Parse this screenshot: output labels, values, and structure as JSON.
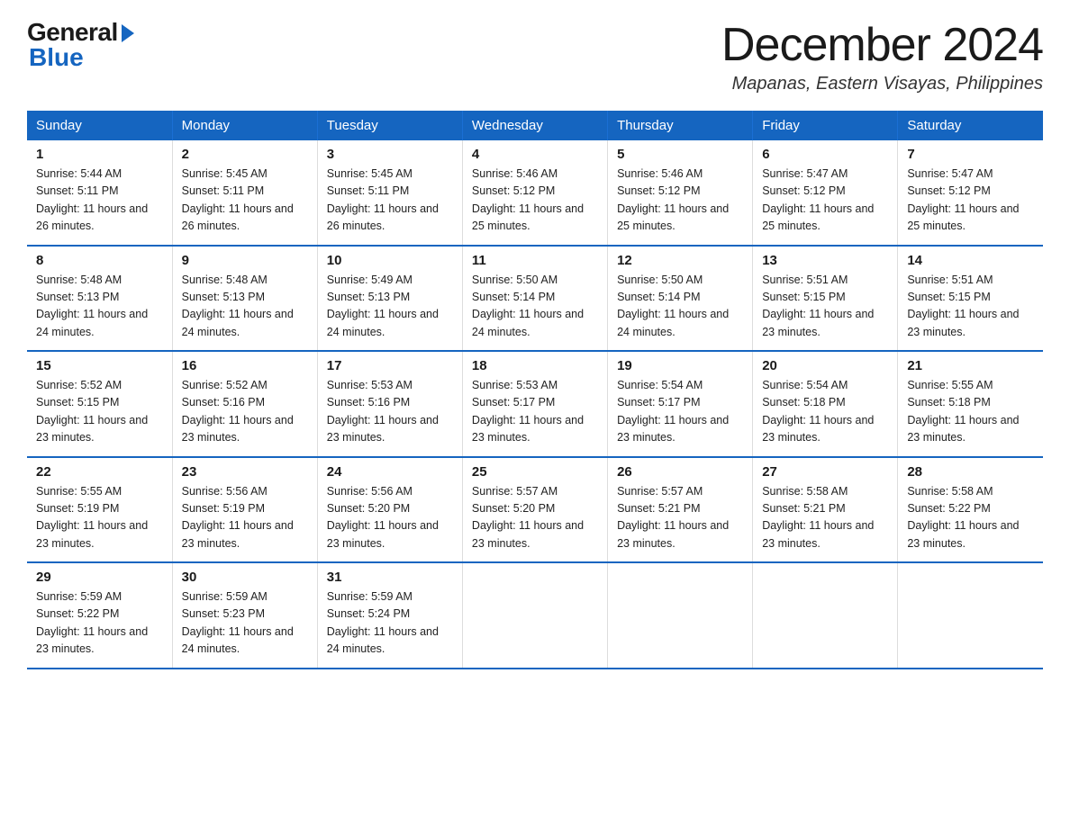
{
  "logo": {
    "general": "General",
    "blue": "Blue"
  },
  "header": {
    "month": "December 2024",
    "location": "Mapanas, Eastern Visayas, Philippines"
  },
  "weekdays": [
    "Sunday",
    "Monday",
    "Tuesday",
    "Wednesday",
    "Thursday",
    "Friday",
    "Saturday"
  ],
  "weeks": [
    [
      {
        "day": "1",
        "sunrise": "5:44 AM",
        "sunset": "5:11 PM",
        "daylight": "11 hours and 26 minutes."
      },
      {
        "day": "2",
        "sunrise": "5:45 AM",
        "sunset": "5:11 PM",
        "daylight": "11 hours and 26 minutes."
      },
      {
        "day": "3",
        "sunrise": "5:45 AM",
        "sunset": "5:11 PM",
        "daylight": "11 hours and 26 minutes."
      },
      {
        "day": "4",
        "sunrise": "5:46 AM",
        "sunset": "5:12 PM",
        "daylight": "11 hours and 25 minutes."
      },
      {
        "day": "5",
        "sunrise": "5:46 AM",
        "sunset": "5:12 PM",
        "daylight": "11 hours and 25 minutes."
      },
      {
        "day": "6",
        "sunrise": "5:47 AM",
        "sunset": "5:12 PM",
        "daylight": "11 hours and 25 minutes."
      },
      {
        "day": "7",
        "sunrise": "5:47 AM",
        "sunset": "5:12 PM",
        "daylight": "11 hours and 25 minutes."
      }
    ],
    [
      {
        "day": "8",
        "sunrise": "5:48 AM",
        "sunset": "5:13 PM",
        "daylight": "11 hours and 24 minutes."
      },
      {
        "day": "9",
        "sunrise": "5:48 AM",
        "sunset": "5:13 PM",
        "daylight": "11 hours and 24 minutes."
      },
      {
        "day": "10",
        "sunrise": "5:49 AM",
        "sunset": "5:13 PM",
        "daylight": "11 hours and 24 minutes."
      },
      {
        "day": "11",
        "sunrise": "5:50 AM",
        "sunset": "5:14 PM",
        "daylight": "11 hours and 24 minutes."
      },
      {
        "day": "12",
        "sunrise": "5:50 AM",
        "sunset": "5:14 PM",
        "daylight": "11 hours and 24 minutes."
      },
      {
        "day": "13",
        "sunrise": "5:51 AM",
        "sunset": "5:15 PM",
        "daylight": "11 hours and 23 minutes."
      },
      {
        "day": "14",
        "sunrise": "5:51 AM",
        "sunset": "5:15 PM",
        "daylight": "11 hours and 23 minutes."
      }
    ],
    [
      {
        "day": "15",
        "sunrise": "5:52 AM",
        "sunset": "5:15 PM",
        "daylight": "11 hours and 23 minutes."
      },
      {
        "day": "16",
        "sunrise": "5:52 AM",
        "sunset": "5:16 PM",
        "daylight": "11 hours and 23 minutes."
      },
      {
        "day": "17",
        "sunrise": "5:53 AM",
        "sunset": "5:16 PM",
        "daylight": "11 hours and 23 minutes."
      },
      {
        "day": "18",
        "sunrise": "5:53 AM",
        "sunset": "5:17 PM",
        "daylight": "11 hours and 23 minutes."
      },
      {
        "day": "19",
        "sunrise": "5:54 AM",
        "sunset": "5:17 PM",
        "daylight": "11 hours and 23 minutes."
      },
      {
        "day": "20",
        "sunrise": "5:54 AM",
        "sunset": "5:18 PM",
        "daylight": "11 hours and 23 minutes."
      },
      {
        "day": "21",
        "sunrise": "5:55 AM",
        "sunset": "5:18 PM",
        "daylight": "11 hours and 23 minutes."
      }
    ],
    [
      {
        "day": "22",
        "sunrise": "5:55 AM",
        "sunset": "5:19 PM",
        "daylight": "11 hours and 23 minutes."
      },
      {
        "day": "23",
        "sunrise": "5:56 AM",
        "sunset": "5:19 PM",
        "daylight": "11 hours and 23 minutes."
      },
      {
        "day": "24",
        "sunrise": "5:56 AM",
        "sunset": "5:20 PM",
        "daylight": "11 hours and 23 minutes."
      },
      {
        "day": "25",
        "sunrise": "5:57 AM",
        "sunset": "5:20 PM",
        "daylight": "11 hours and 23 minutes."
      },
      {
        "day": "26",
        "sunrise": "5:57 AM",
        "sunset": "5:21 PM",
        "daylight": "11 hours and 23 minutes."
      },
      {
        "day": "27",
        "sunrise": "5:58 AM",
        "sunset": "5:21 PM",
        "daylight": "11 hours and 23 minutes."
      },
      {
        "day": "28",
        "sunrise": "5:58 AM",
        "sunset": "5:22 PM",
        "daylight": "11 hours and 23 minutes."
      }
    ],
    [
      {
        "day": "29",
        "sunrise": "5:59 AM",
        "sunset": "5:22 PM",
        "daylight": "11 hours and 23 minutes."
      },
      {
        "day": "30",
        "sunrise": "5:59 AM",
        "sunset": "5:23 PM",
        "daylight": "11 hours and 24 minutes."
      },
      {
        "day": "31",
        "sunrise": "5:59 AM",
        "sunset": "5:24 PM",
        "daylight": "11 hours and 24 minutes."
      },
      null,
      null,
      null,
      null
    ]
  ]
}
